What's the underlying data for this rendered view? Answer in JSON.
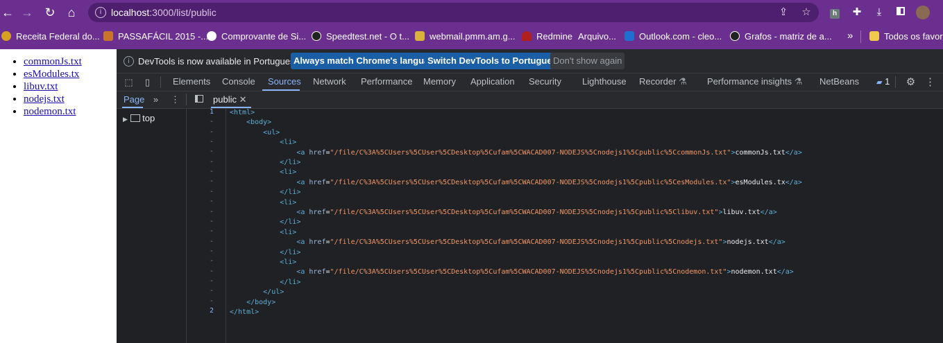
{
  "browser": {
    "url_host": "localhost",
    "url_rest": ":3000/list/public"
  },
  "bookmarks": [
    {
      "label": "Receita Federal do...",
      "color": "#d6a021"
    },
    {
      "label": "PASSAFÁCIL 2015 -...",
      "color": "#c8742a"
    },
    {
      "label": "Comprovante de Si...",
      "color": "#ffffff"
    },
    {
      "label": "Speedtest.net - O t...",
      "color": "#222222"
    },
    {
      "label": "webmail.pmm.am.g...",
      "color": "#d9b23b"
    },
    {
      "label": "Redmine",
      "color": "#b02020"
    },
    {
      "label": "Arquivo...",
      "color": "#6a2f8f"
    },
    {
      "label": "Outlook.com - cleo...",
      "color": "#1f6fd1"
    },
    {
      "label": "Grafos - matriz de a...",
      "color": "#222222"
    },
    {
      "label": "»",
      "color": ""
    },
    {
      "label": "Todos os favorit",
      "color": "#f2c94c"
    }
  ],
  "page": {
    "links": [
      "commonJs.txt",
      "esModules.tx",
      "libuv.txt",
      "nodejs.txt",
      "nodemon.txt"
    ]
  },
  "devtools": {
    "infobar": {
      "message": "DevTools is now available in Portuguese!",
      "btn_match": "Always match Chrome's language",
      "btn_switch": "Switch DevTools to Portuguese",
      "btn_dismiss": "Don't show again"
    },
    "tabs": [
      "Elements",
      "Console",
      "Sources",
      "Network",
      "Performance",
      "Memory",
      "Application",
      "Security",
      "Lighthouse",
      "Recorder",
      "Performance insights",
      "NetBeans"
    ],
    "active_tab": "Sources",
    "issues_count": "1",
    "navigator": {
      "tab": "Page",
      "tree_item": "top"
    },
    "editor": {
      "file_tab": "public",
      "line_numbers": [
        "1",
        "-",
        "-",
        "-",
        "-",
        "-",
        "-",
        "-",
        "-",
        "-",
        "-",
        "-",
        "-",
        "-",
        "-",
        "-",
        "-",
        "-",
        "-",
        "-",
        "2"
      ],
      "hrefs": [
        "\"/file/C%3A%5CUsers%5CUser%5CDesktop%5Cufam%5CWACAD007-NODEJS%5Cnodejs1%5Cpublic%5CcommonJs.txt\"",
        "\"/file/C%3A%5CUsers%5CUser%5CDesktop%5Cufam%5CWACAD007-NODEJS%5Cnodejs1%5Cpublic%5CesModules.tx\"",
        "\"/file/C%3A%5CUsers%5CUser%5CDesktop%5Cufam%5CWACAD007-NODEJS%5Cnodejs1%5Cpublic%5Clibuv.txt\"",
        "\"/file/C%3A%5CUsers%5CUser%5CDesktop%5Cufam%5CWACAD007-NODEJS%5Cnodejs1%5Cpublic%5Cnodejs.txt\"",
        "\"/file/C%3A%5CUsers%5CUser%5CDesktop%5Cufam%5CWACAD007-NODEJS%5Cnodejs1%5Cpublic%5Cnodemon.txt\""
      ],
      "link_texts": [
        "commonJs.txt",
        "esModules.tx",
        "libuv.txt",
        "nodejs.txt",
        "nodemon.txt"
      ]
    }
  }
}
